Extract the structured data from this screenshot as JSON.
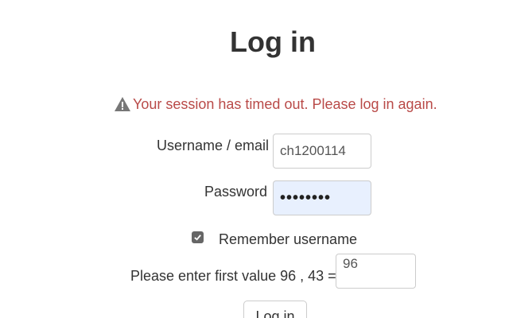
{
  "page": {
    "title": "Log in"
  },
  "alert": {
    "icon": "warning-icon",
    "message": "Your session has timed out. Please log in again.",
    "color": "#b94a48"
  },
  "form": {
    "username_label": "Username / email",
    "username_value": "ch1200114",
    "password_label": "Password",
    "password_value": "••••••••",
    "remember_label": "Remember username",
    "remember_checked": true,
    "captcha_label": "Please enter first value 96 , 43 =",
    "captcha_value": "96",
    "login_button_label": "Log in"
  }
}
